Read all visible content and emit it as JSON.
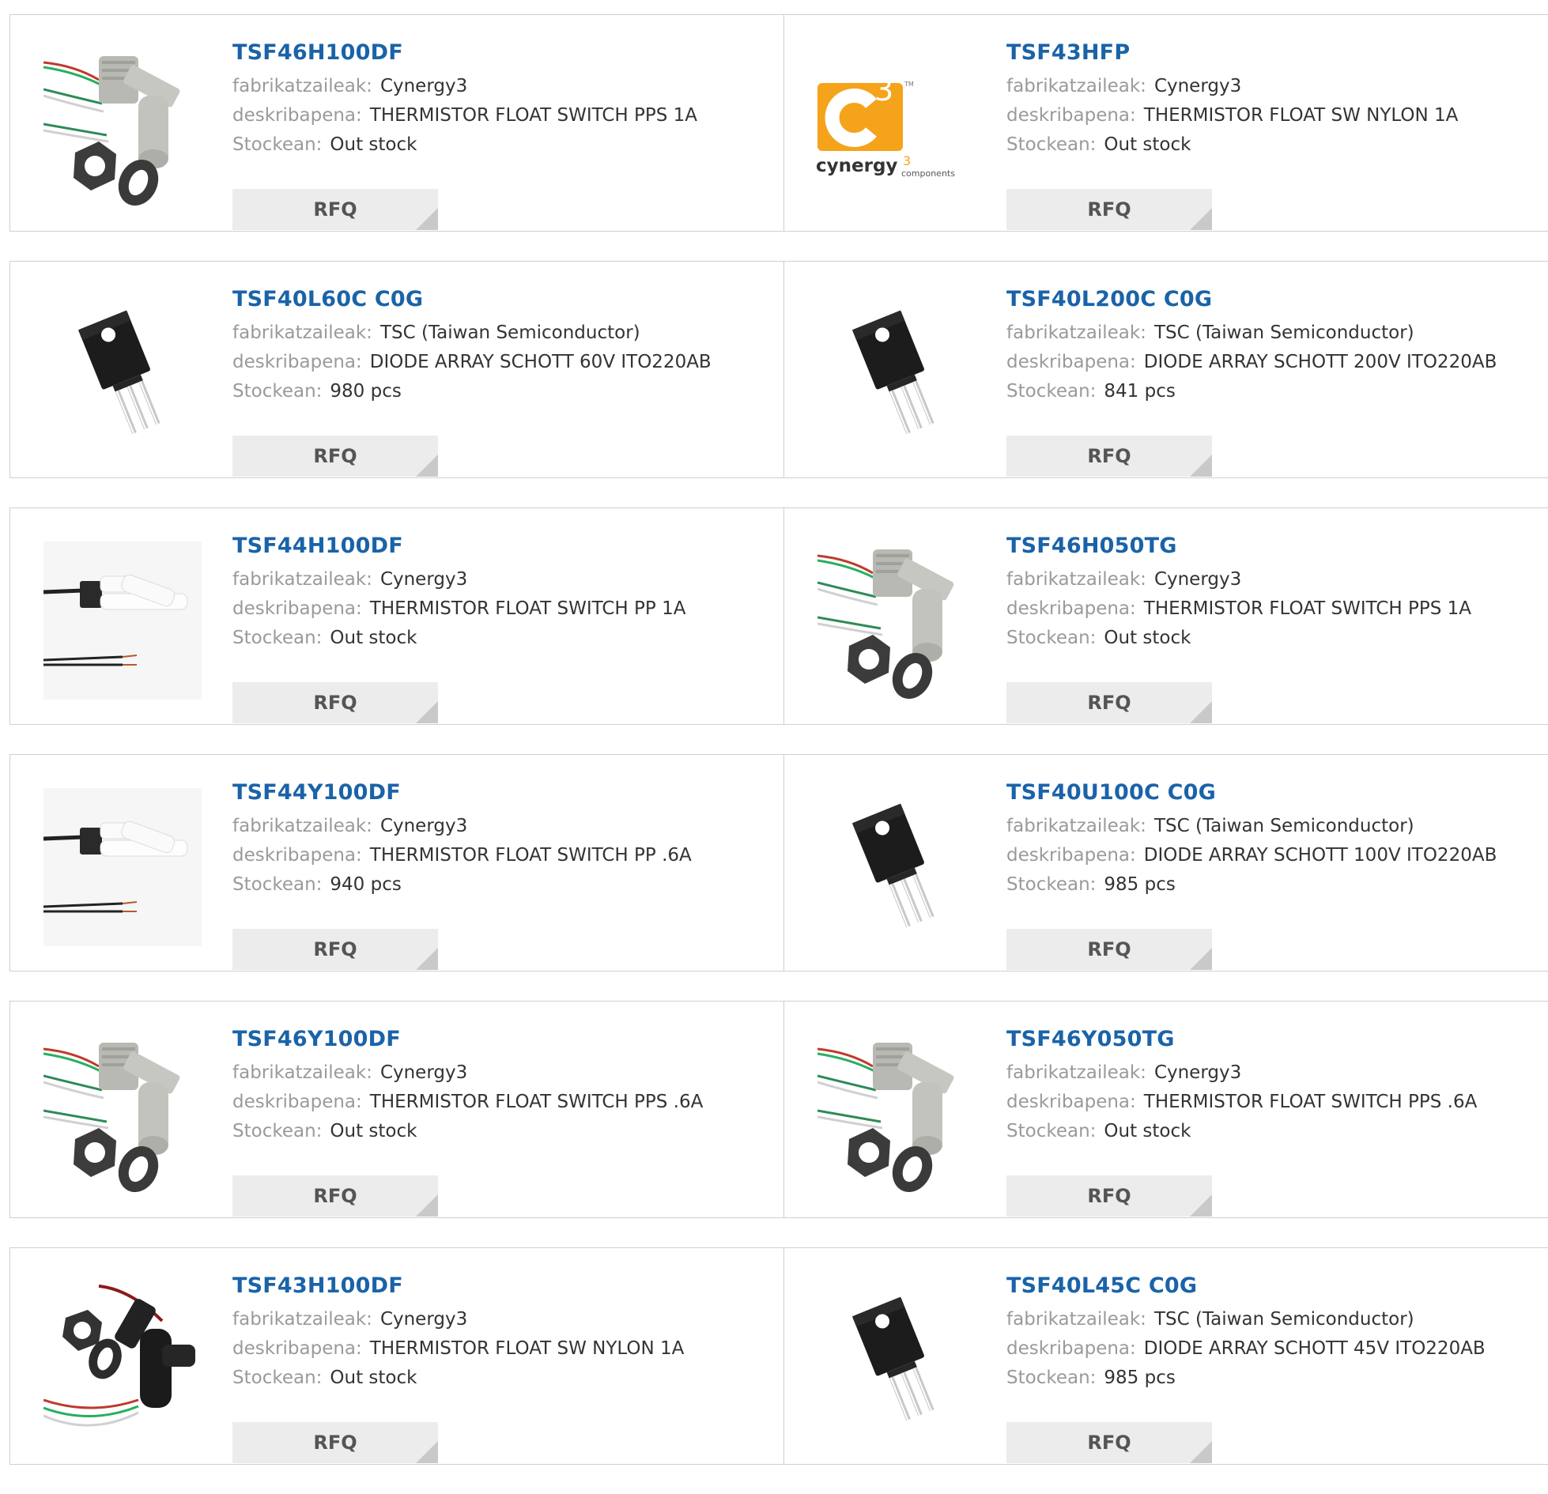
{
  "labels": {
    "manufacturer": "fabrikatzaileak:",
    "description": "deskribapena:",
    "stock": "Stockean:",
    "rfq": "RFQ"
  },
  "logo": {
    "main": "cynergy",
    "super": "3",
    "sub": "components",
    "tm": "TM",
    "brand_color": "#f5a31a"
  },
  "products": [
    {
      "part": "TSF46H100DF",
      "manufacturer": "Cynergy3",
      "description": "THERMISTOR FLOAT SWITCH PPS 1A",
      "stock": "Out stock",
      "image": "float-switch-gray-icon"
    },
    {
      "part": "TSF43HFP",
      "manufacturer": "Cynergy3",
      "description": "THERMISTOR FLOAT SW NYLON 1A",
      "stock": "Out stock",
      "image": "cynergy3-logo"
    },
    {
      "part": "TSF40L60C C0G",
      "manufacturer": "TSC (Taiwan Semiconductor)",
      "description": "DIODE ARRAY SCHOTT 60V ITO220AB",
      "stock": "980 pcs",
      "image": "to220-package-icon"
    },
    {
      "part": "TSF40L200C C0G",
      "manufacturer": "TSC (Taiwan Semiconductor)",
      "description": "DIODE ARRAY SCHOTT 200V ITO220AB",
      "stock": "841 pcs",
      "image": "to220-package-icon"
    },
    {
      "part": "TSF44H100DF",
      "manufacturer": "Cynergy3",
      "description": "THERMISTOR FLOAT SWITCH PP 1A",
      "stock": "Out stock",
      "image": "float-switch-white-icon"
    },
    {
      "part": "TSF46H050TG",
      "manufacturer": "Cynergy3",
      "description": "THERMISTOR FLOAT SWITCH PPS 1A",
      "stock": "Out stock",
      "image": "float-switch-gray-icon"
    },
    {
      "part": "TSF44Y100DF",
      "manufacturer": "Cynergy3",
      "description": "THERMISTOR FLOAT SWITCH PP .6A",
      "stock": "940 pcs",
      "image": "float-switch-white-icon"
    },
    {
      "part": "TSF40U100C C0G",
      "manufacturer": "TSC (Taiwan Semiconductor)",
      "description": "DIODE ARRAY SCHOTT 100V ITO220AB",
      "stock": "985 pcs",
      "image": "to220-package-icon"
    },
    {
      "part": "TSF46Y100DF",
      "manufacturer": "Cynergy3",
      "description": "THERMISTOR FLOAT SWITCH PPS .6A",
      "stock": "Out stock",
      "image": "float-switch-gray-icon"
    },
    {
      "part": "TSF46Y050TG",
      "manufacturer": "Cynergy3",
      "description": "THERMISTOR FLOAT SWITCH PPS .6A",
      "stock": "Out stock",
      "image": "float-switch-gray-icon"
    },
    {
      "part": "TSF43H100DF",
      "manufacturer": "Cynergy3",
      "description": "THERMISTOR FLOAT SW NYLON 1A",
      "stock": "Out stock",
      "image": "float-switch-black-icon"
    },
    {
      "part": "TSF40L45C C0G",
      "manufacturer": "TSC (Taiwan Semiconductor)",
      "description": "DIODE ARRAY SCHOTT 45V ITO220AB",
      "stock": "985 pcs",
      "image": "to220-package-icon"
    }
  ]
}
